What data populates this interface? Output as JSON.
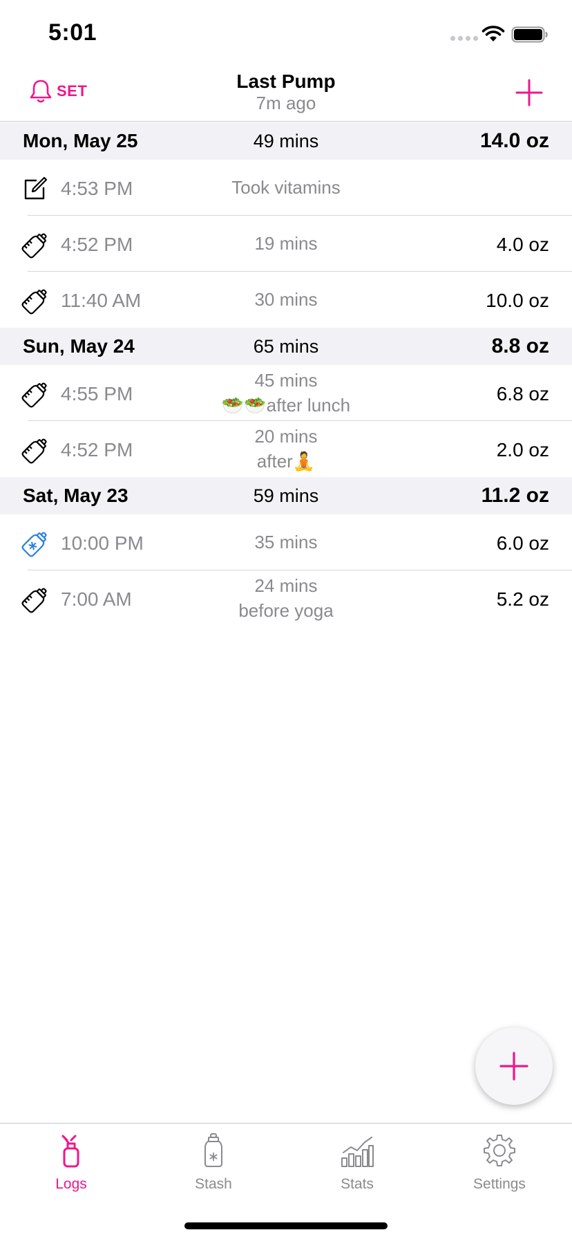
{
  "status_bar": {
    "time": "5:01"
  },
  "nav": {
    "alarm_label": "SET",
    "title": "Last Pump",
    "subtitle": "7m ago"
  },
  "colors": {
    "accent": "#f0168c",
    "frozen": "#2b7fe0",
    "header_bg": "#f2f2f6",
    "secondary_text": "#8a8a8e"
  },
  "days": [
    {
      "date": "Mon, May 25",
      "duration": "49 mins",
      "total": "14.0 oz",
      "entries": [
        {
          "icon": "note-icon",
          "time": "4:53 PM",
          "duration": "Took vitamins",
          "note": "",
          "amount": ""
        },
        {
          "icon": "bottle-icon",
          "time": "4:52 PM",
          "duration": "19 mins",
          "note": "",
          "amount": "4.0 oz"
        },
        {
          "icon": "bottle-icon",
          "time": "11:40 AM",
          "duration": "30 mins",
          "note": "",
          "amount": "10.0 oz"
        }
      ]
    },
    {
      "date": "Sun, May 24",
      "duration": "65 mins",
      "total": "8.8 oz",
      "entries": [
        {
          "icon": "bottle-icon",
          "time": "4:55 PM",
          "duration": "45 mins",
          "note": "🥗🥗after lunch",
          "amount": "6.8 oz"
        },
        {
          "icon": "bottle-icon",
          "time": "4:52 PM",
          "duration": "20 mins",
          "note": "after🧘",
          "amount": "2.0 oz"
        }
      ]
    },
    {
      "date": "Sat, May 23",
      "duration": "59 mins",
      "total": "11.2 oz",
      "entries": [
        {
          "icon": "frozen-bottle-icon",
          "time": "10:00 PM",
          "duration": "35 mins",
          "note": "",
          "amount": "6.0 oz"
        },
        {
          "icon": "bottle-icon",
          "time": "7:00 AM",
          "duration": "24 mins",
          "note": "before yoga",
          "amount": "5.2 oz"
        }
      ]
    }
  ],
  "tabs": [
    {
      "label": "Logs",
      "icon": "pump-icon",
      "active": true
    },
    {
      "label": "Stash",
      "icon": "stash-bottle-icon",
      "active": false
    },
    {
      "label": "Stats",
      "icon": "stats-icon",
      "active": false
    },
    {
      "label": "Settings",
      "icon": "gear-icon",
      "active": false
    }
  ]
}
